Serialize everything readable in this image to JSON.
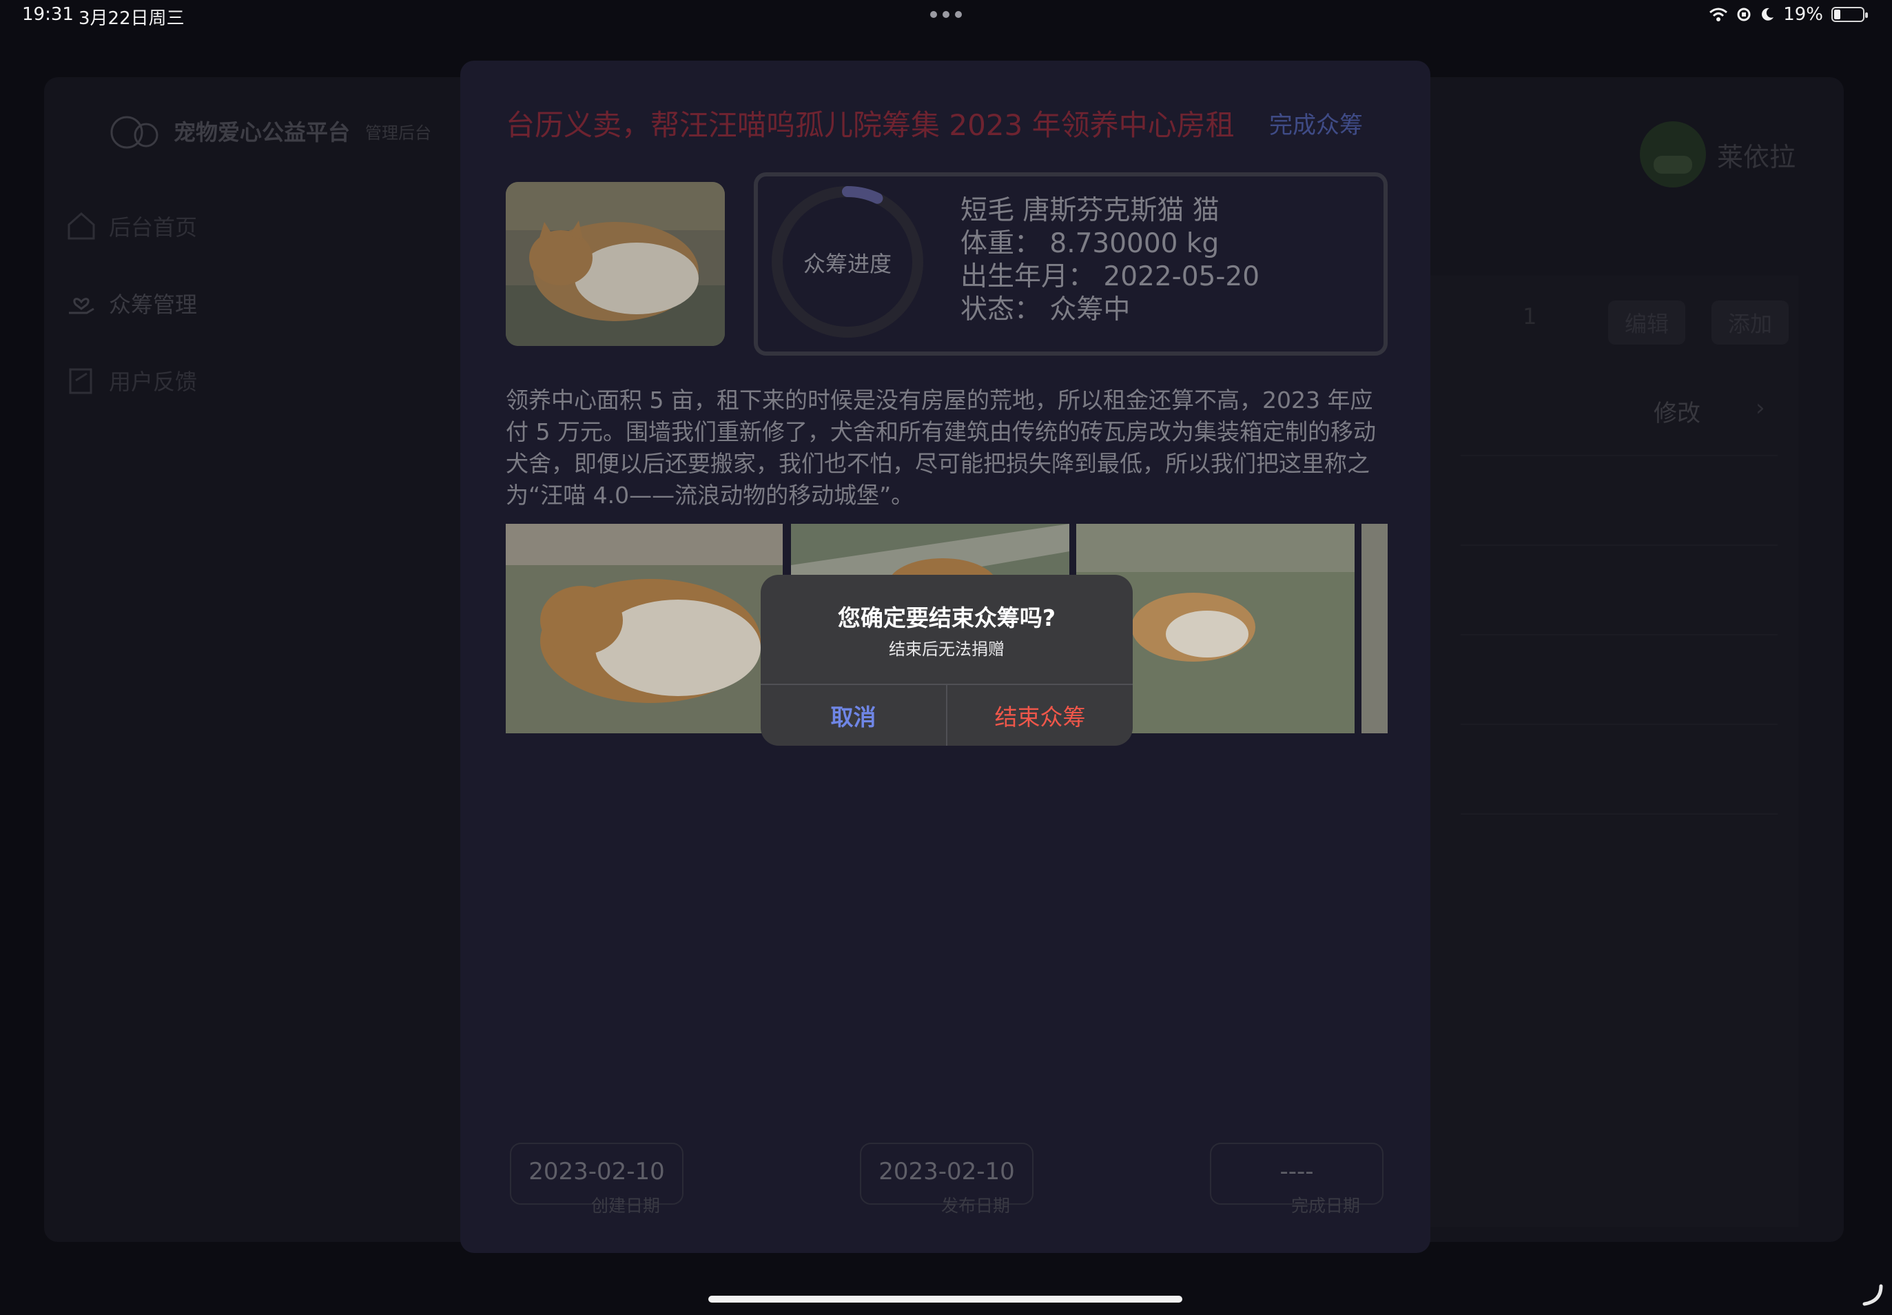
{
  "status_bar": {
    "time": "19:31",
    "date": "3月22日周三",
    "battery": "19%"
  },
  "background_app": {
    "brand": "宠物爱心公益平台",
    "brand_sub": "管理后台",
    "menu": [
      {
        "label": "后台首页",
        "icon": "home-icon"
      },
      {
        "label": "众筹管理",
        "icon": "heart-hand-icon"
      },
      {
        "label": "用户反馈",
        "icon": "feedback-icon"
      }
    ],
    "username": "莱依拉",
    "stepper_value": "1",
    "edit_button": "编辑",
    "add_button": "添加",
    "row_action": "修改"
  },
  "campaign": {
    "title": "台历义卖，帮汪汪喵呜孤儿院筹集 2023 年领养中心房租",
    "finish_link": "完成众筹",
    "progress_label": "众筹进度",
    "progress_fraction": 0.07,
    "pet_breed": "短毛  唐斯芬克斯猫  猫",
    "weight": "体重：  8.730000 kg",
    "birth": "出生年月：  2022-05-20",
    "status": "状态：  众筹中",
    "description": "领养中心面积 5 亩，租下来的时候是没有房屋的荒地，所以租金还算不高，2023 年应付 5 万元。围墙我们重新修了，犬舍和所有建筑由传统的砖瓦房改为集装箱定制的移动犬舍，即便以后还要搬家，我们也不怕，尽可能把损失降到最低，所以我们把这里称之为“汪喵 4.0——流浪动物的移动城堡”。",
    "dates": [
      {
        "value": "2023-02-10",
        "label": "创建日期"
      },
      {
        "value": "2023-02-10",
        "label": "发布日期"
      },
      {
        "value": "----",
        "label": "完成日期"
      }
    ]
  },
  "alert": {
    "title": "您确定要结束众筹吗?",
    "message": "结束后无法捐赠",
    "cancel": "取消",
    "confirm": "结束众筹"
  },
  "colors": {
    "accent_blue": "#6f86e6",
    "destructive_red": "#f0574a",
    "sheet_bg": "#1b1a2b",
    "title_red": "#6e2330"
  }
}
